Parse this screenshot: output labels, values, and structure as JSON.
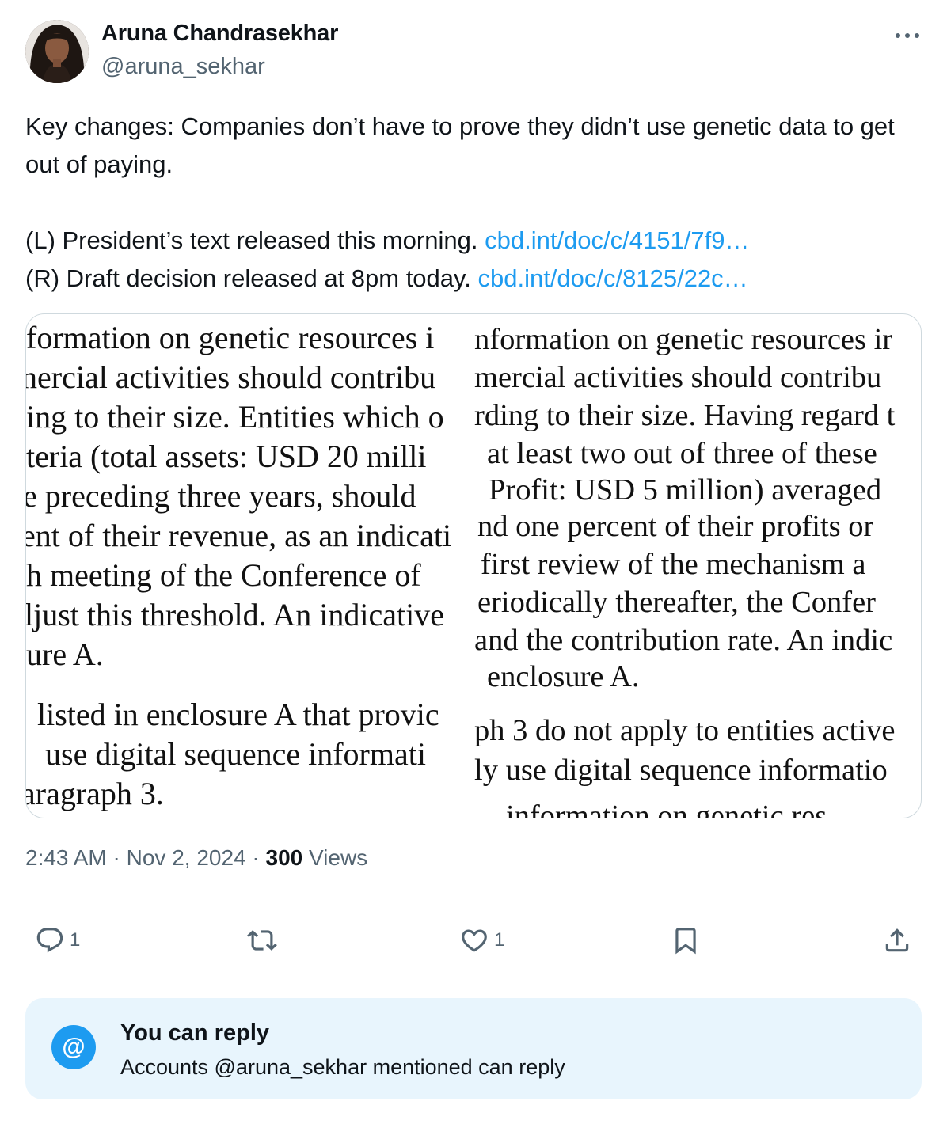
{
  "author": {
    "display_name": "Aruna Chandrasekhar",
    "handle": "@aruna_sekhar",
    "avatar_icon": "profile-photo"
  },
  "more_icon": "more-dots-icon",
  "tweet": {
    "line1": "Key changes: Companies don’t have to prove they didn’t use genetic data to get out of paying.",
    "left_label": "(L) President’s text released this morning.",
    "left_link": "cbd.int/doc/c/4151/7f9…",
    "right_label": "(R) Draft decision released at 8pm today.",
    "right_link": "cbd.int/doc/c/8125/22c…"
  },
  "media": {
    "left_lines": [
      "formation on genetic resources i",
      "nercial activities should contribu",
      "ing to their size. Entities which o",
      "teria (total assets: USD 20 milli",
      "e preceding three years, should",
      "ent of their revenue, as an indicati",
      "h meeting of the Conference of",
      "ljust this threshold. An indicative",
      "ure A.",
      "listed in enclosure A that provic",
      "use digital sequence informati",
      "aragraph 3."
    ],
    "right_lines": [
      "nformation on genetic resources ir",
      "mercial activities should contribu",
      "rding to their size. Having regard t",
      "at least two out of three of these",
      "Profit: USD 5 million) averaged",
      "nd one percent of their profits or",
      "first review of the mechanism a",
      "eriodically thereafter, the Confer",
      "and the contribution rate. An indic",
      "enclosure A.",
      "ph 3 do not apply to entities active",
      "ly use digital sequence informatio",
      "information on genetic res"
    ]
  },
  "meta": {
    "time": "2:43 AM",
    "separator": " · ",
    "date": "Nov 2, 2024",
    "views_count": "300",
    "views_label": "Views"
  },
  "actions": {
    "reply_count": "1",
    "like_count": "1"
  },
  "reply_settings": {
    "icon_symbol": "@",
    "title": "You can reply",
    "subtitle": "Accounts @aruna_sekhar mentioned can reply"
  }
}
